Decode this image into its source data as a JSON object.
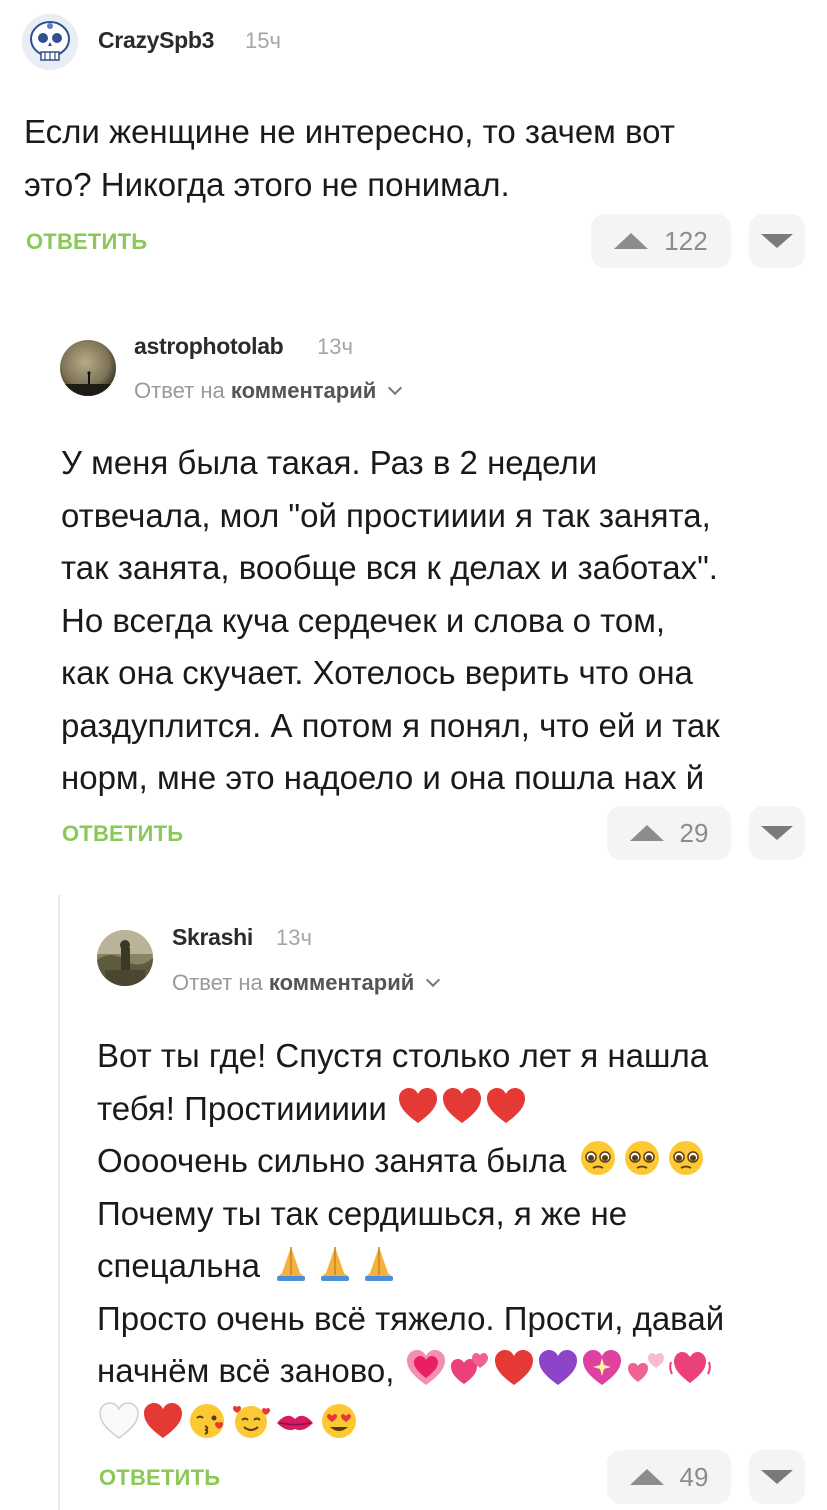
{
  "comments": [
    {
      "author": "CrazySpb3",
      "time": "15ч",
      "lines": [
        "Если женщине не интересно, то зачем вот",
        "это? Никогда этого не понимал."
      ],
      "reply_label": "ОТВЕТИТЬ",
      "votes": "122"
    },
    {
      "author": "astrophotolab",
      "time": "13ч",
      "reply_to_prefix": "Ответ на",
      "reply_to_link": "комментарий",
      "lines": [
        "У меня была такая. Раз в 2 недели",
        "отвечала, мол \"ой простииии я так занята,",
        "так занята, вообще вся к делах и заботах\".",
        "Но всегда куча сердечек и слова о том,",
        "как она скучает. Хотелось верить что она",
        "раздуплится. А потом я понял, что ей и так",
        "норм, мне это надоело и она пошла нах  й"
      ],
      "reply_label": "ОТВЕТИТЬ",
      "votes": "29"
    },
    {
      "author": "Skrashi",
      "time": "13ч",
      "reply_to_prefix": "Ответ на",
      "reply_to_link": "комментарий",
      "lines": [
        "Вот ты где! Спустя столько лет я нашла",
        "тебя! Простииииии",
        "Оооочень сильно занята была",
        "Почему ты так сердишься, я же не",
        "спецальна",
        "Просто очень всё тяжело. Прости, давай",
        "начнём всё заново,"
      ],
      "reply_label": "ОТВЕТИТЬ",
      "votes": "49"
    }
  ],
  "emoji_names": {
    "hearts_line2": [
      "red-heart",
      "red-heart",
      "red-heart"
    ],
    "pleading_line3": [
      "pleading-face",
      "pleading-face",
      "pleading-face"
    ],
    "pray_line5": [
      "folded-hands",
      "folded-hands",
      "folded-hands"
    ],
    "line7": [
      "growing-heart",
      "two-hearts",
      "red-heart",
      "purple-heart",
      "sparkling-heart",
      "revolving-hearts",
      "beating-heart"
    ],
    "line8": [
      "white-heart",
      "red-heart",
      "kissing-face",
      "smiling-face-with-hearts",
      "kiss-mark",
      "heart-eyes-face"
    ]
  },
  "colors": {
    "accent": "#8ac858",
    "muted": "#a5a5a5",
    "vote_bg": "#f4f4f4"
  }
}
